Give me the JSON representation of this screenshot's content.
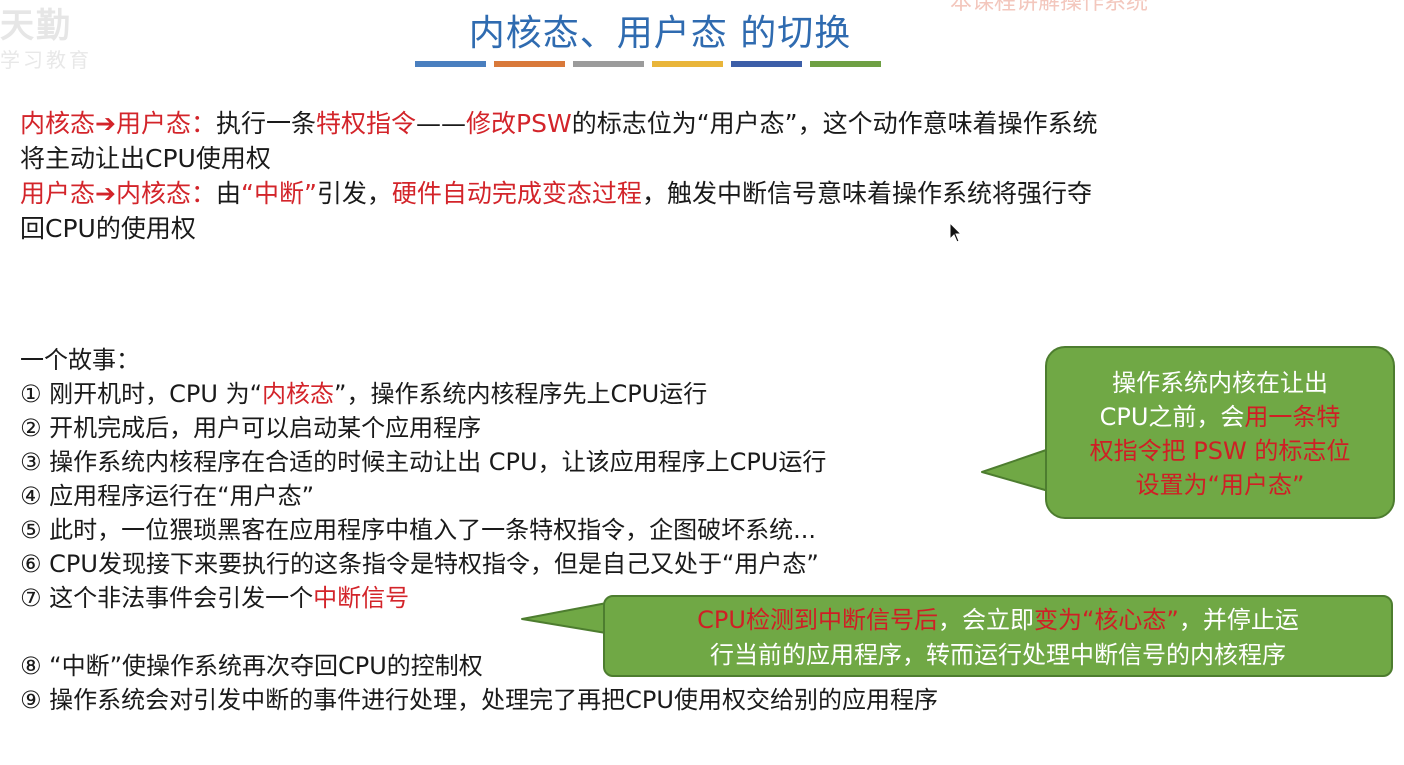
{
  "watermark": {
    "main": "天勤",
    "sub": "学习教育",
    "corner": "本课程讲解操作系统"
  },
  "header": {
    "title": "内核态、用户态 的切换",
    "bar_colors": [
      "#4a7fbf",
      "#d9793a",
      "#9b9b9b",
      "#e9b53a",
      "#3c5ea8",
      "#6fa044"
    ]
  },
  "intro": {
    "line1": {
      "a": "内核态",
      "arrow": "➔",
      "b": "用户态：",
      "c": "执行一条",
      "d": "特权指令",
      "e": "——",
      "f": "修改PSW",
      "g": "的标志位为“用户态”，这个动作意味着操作系统",
      "h": "将主动让出CPU使用权"
    },
    "line2": {
      "a": "用户态",
      "arrow": "➔",
      "b": "内核态：",
      "c": "由",
      "d": "“中断”",
      "e": "引发，",
      "f": "硬件自动完成变态过程",
      "g": "，触发中断信号意味着操作系统将强行夺",
      "h": "回CPU的使用权"
    }
  },
  "story": {
    "heading": "一个故事：",
    "s1": {
      "pre": "① 刚开机时，CPU 为“",
      "hl": "内核态",
      "post": "”，操作系统内核程序先上CPU运行"
    },
    "s2": "② 开机完成后，用户可以启动某个应用程序",
    "s3": "③ 操作系统内核程序在合适的时候主动让出 CPU，让该应用程序上CPU运行",
    "s4": "④ 应用程序运行在“用户态”",
    "s5": "⑤ 此时，一位猥琐黑客在应用程序中植入了一条特权指令，企图破坏系统...",
    "s6": "⑥ CPU发现接下来要执行的这条指令是特权指令，但是自己又处于“用户态”",
    "s7": {
      "pre": "⑦ 这个非法事件会引发一个",
      "hl": "中断信号"
    },
    "s8": "⑧ “中断”使操作系统再次夺回CPU的控制权",
    "s9": "⑨ 操作系统会对引发中断的事件进行处理，处理完了再把CPU使用权交给别的应用程序"
  },
  "callout1": {
    "l1": "操作系统内核在让出",
    "l2a": "CPU之前，会",
    "l2b": "用一条特",
    "l3": "权指令把 PSW 的标志位",
    "l4": "设置为“用户态”"
  },
  "callout2": {
    "a": "CPU检测到中断信号后",
    "b": "，会立即",
    "c": "变为“核心态”",
    "d": "，并停止运",
    "e": "行当前的应用程序，转而运行处理中断信号的内核程序"
  },
  "colors": {
    "accent_red": "#d3242a",
    "title_blue": "#2f6bb0",
    "callout_green": "#70a845"
  }
}
